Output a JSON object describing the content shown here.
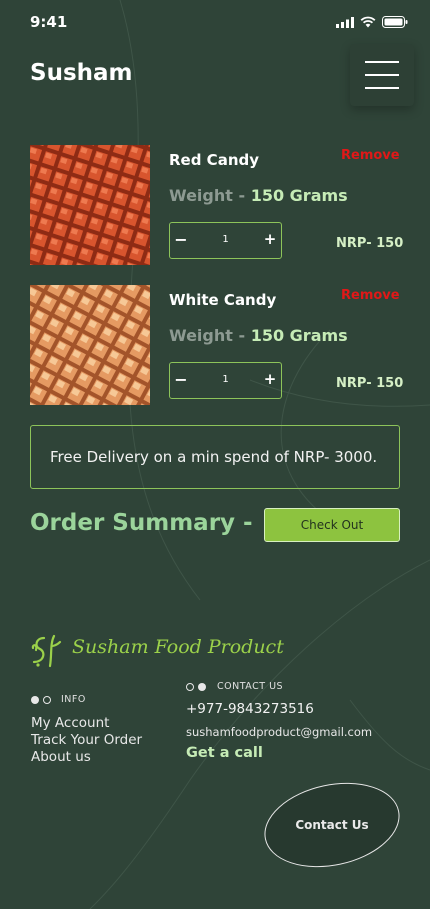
{
  "status_bar": {
    "time": "9:41"
  },
  "header": {
    "brand": "Susham",
    "menu_icon": "hamburger-menu-icon"
  },
  "cart": {
    "items": [
      {
        "name": "Red Candy",
        "remove_label": "Remove",
        "weight_label": "Weight -",
        "weight_value": "150 Grams",
        "minus": "−",
        "quantity": "1",
        "plus": "+",
        "price": "NRP- 150",
        "image_desc": "red candy cubes"
      },
      {
        "name": "White Candy",
        "remove_label": "Remove",
        "weight_label": "Weight -",
        "weight_value": "150 Grams",
        "minus": "−",
        "quantity": "1",
        "plus": "+",
        "price": "NRP- 150",
        "image_desc": "white candy cubes"
      }
    ]
  },
  "delivery_notice": "Free Delivery on a min spend of NRP- 3000.",
  "order_summary": {
    "title": "Order Summary -",
    "checkout_label": "Check Out"
  },
  "footer": {
    "logo_text": "Susham Food Product",
    "info": {
      "label": "INFO",
      "links": [
        "My Account",
        "Track Your Order",
        "About us"
      ]
    },
    "contact": {
      "label": "CONTACT US",
      "phone": "+977-9843273516",
      "email": "sushamfoodproduct@gmail.com",
      "get_call": "Get a call"
    },
    "contact_button": "Contact Us"
  },
  "colors": {
    "background": "#2f4438",
    "accent_green": "#8dc33f",
    "remove_red": "#e01818",
    "summary_green": "#9bd49b"
  }
}
